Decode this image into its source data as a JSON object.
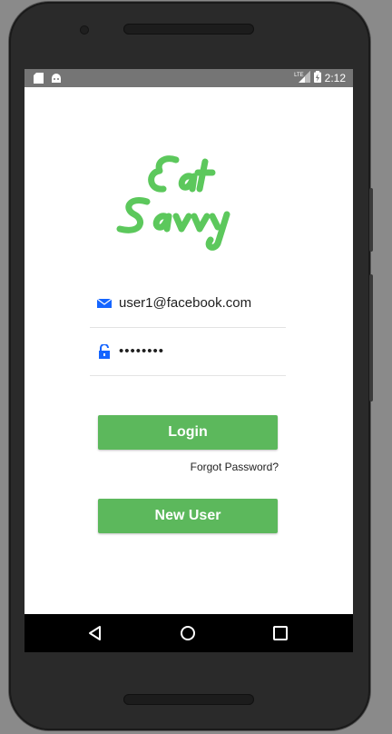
{
  "status_bar": {
    "time": "2:12",
    "network": "LTE",
    "icons": [
      "sd-card-icon",
      "android-icon",
      "signal-icon",
      "battery-icon"
    ]
  },
  "app": {
    "logo_text_line1": "Eat",
    "logo_text_line2": "Savvy",
    "brand_color": "#5cb85c"
  },
  "login_form": {
    "email_value": "user1@facebook.com",
    "password_value": "••••••••",
    "login_label": "Login",
    "forgot_label": "Forgot Password?",
    "new_user_label": "New User"
  },
  "nav_bar": {
    "icons": [
      "back-icon",
      "home-icon",
      "recents-icon"
    ]
  }
}
